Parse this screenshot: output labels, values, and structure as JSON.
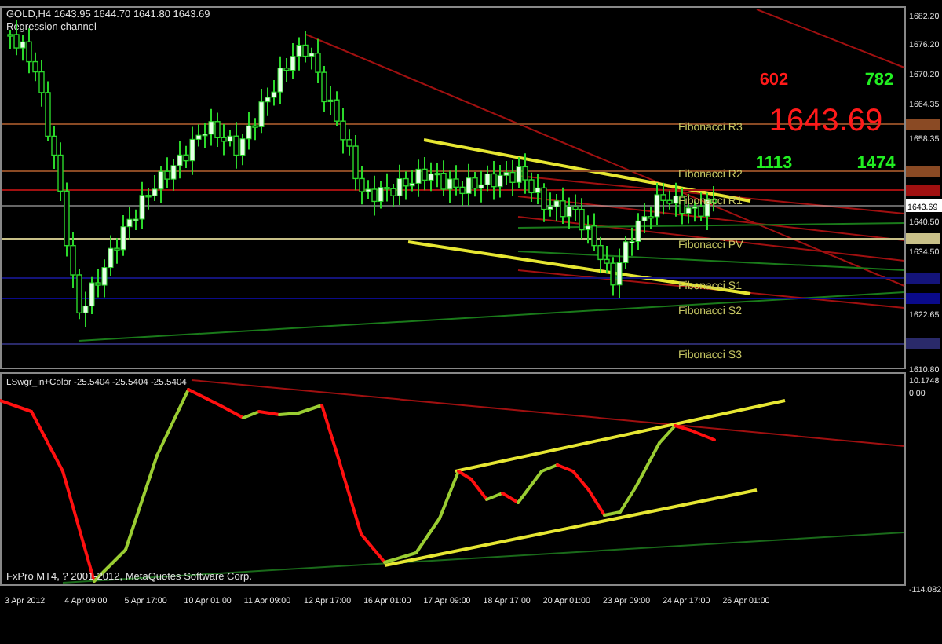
{
  "chart": {
    "header": "GOLD,H4  1643.95 1644.70 1641.80 1643.69",
    "subtitle": "Regression channel",
    "big_price": "1643.69",
    "counters": [
      {
        "text": "602",
        "color": "#ff1a1a"
      },
      {
        "text": "782",
        "color": "#22ee22"
      },
      {
        "text": "1113",
        "color": "#22ee22"
      },
      {
        "text": "1474",
        "color": "#22ee22"
      }
    ],
    "fib_levels": [
      {
        "label": "Fibonacci R3",
        "color": "#8a4a24"
      },
      {
        "label": "Fibonacci R2",
        "color": "#8a4a24"
      },
      {
        "label": "Fibonacci R1",
        "color": "#a01010"
      },
      {
        "label": "Fibonacci PV",
        "color": "#c8c088"
      },
      {
        "label": "Fibonacci S1",
        "color": "#14147a"
      },
      {
        "label": "Fibonacci S2",
        "color": "#0a0a8a"
      },
      {
        "label": "Fibonacci S3",
        "color": "#2a2a6a"
      }
    ],
    "current_price_tag": "1643.69",
    "price_axis": [
      "1682.20",
      "1676.20",
      "1670.20",
      "1664.35",
      "1658.35",
      "1640.50",
      "1634.50",
      "1622.65",
      "1610.80"
    ]
  },
  "indicator": {
    "title": "LSwgr_in+Color -25.5404 -25.5404 -25.5404",
    "axis": [
      "10.1748",
      "0.00",
      "-114.082"
    ],
    "copyright": "FxPro MT4, ? 2001-2012, MetaQuotes Software Corp."
  },
  "time_axis": [
    "3 Apr 2012",
    "4 Apr 09:00",
    "5 Apr 17:00",
    "10 Apr 01:00",
    "11 Apr 09:00",
    "12 Apr 17:00",
    "16 Apr 01:00",
    "17 Apr 09:00",
    "18 Apr 17:00",
    "20 Apr 01:00",
    "23 Apr 09:00",
    "24 Apr 17:00",
    "26 Apr 01:00"
  ]
}
